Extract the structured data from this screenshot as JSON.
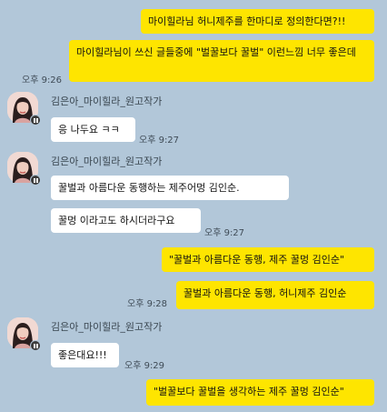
{
  "sender_name": "김은아_마이힐라_원고작가",
  "messages": [
    {
      "text": "마이힐라님 허니제주를 한마디로 정의한다면?!!"
    },
    {
      "text": "마이힐라님이 쓰신 글들중에 \"벌꿀보다 꿀벌\" 이런느낌 너무 좋은데",
      "time": "오후 9:26"
    },
    {
      "text": "응 나두요 ㅋㅋ",
      "time": "오후 9:27"
    },
    {
      "text": "꿀벌과 아름다운 동행하는 제주어멍 김인순."
    },
    {
      "text": "꿀멍 이라고도 하시더라구요",
      "time": "오후 9:27"
    },
    {
      "text": "\"꿀벌과 아름다운 동행, 제주 꿀멍 김인순\""
    },
    {
      "text": "꿀벌과 아름다운 동행, 허니제주 김인순",
      "time": "오후 9:28"
    },
    {
      "text": "좋은대요!!!",
      "time": "오후 9:29"
    },
    {
      "text": "\"벌꿀보다 꿀벌을 생각하는 제주 꿀멍 김인순\""
    }
  ]
}
